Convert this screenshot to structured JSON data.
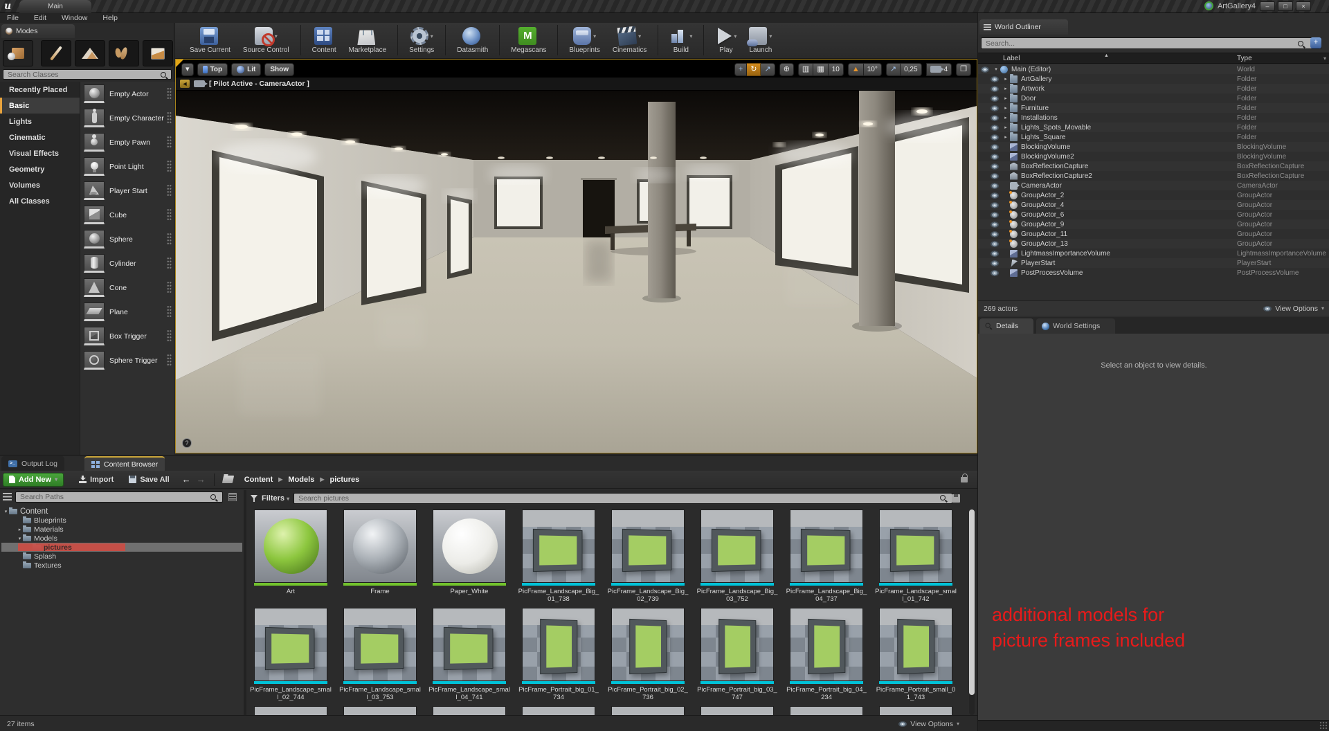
{
  "window": {
    "tab": "Main",
    "project": "ArtGallery4",
    "menu": [
      "File",
      "Edit",
      "Window",
      "Help"
    ],
    "buttons": {
      "minimize": "–",
      "restore": "□",
      "close": "×"
    }
  },
  "modes_panel": {
    "title": "Modes",
    "search_placeholder": "Search Classes",
    "categories": [
      {
        "label": "Recently Placed",
        "cls": ""
      },
      {
        "label": "Basic",
        "cls": "sel"
      },
      {
        "label": "Lights",
        "cls": ""
      },
      {
        "label": "Cinematic",
        "cls": ""
      },
      {
        "label": "Visual Effects",
        "cls": ""
      },
      {
        "label": "Geometry",
        "cls": ""
      },
      {
        "label": "Volumes",
        "cls": ""
      },
      {
        "label": "All Classes",
        "cls": ""
      }
    ],
    "items": [
      {
        "label": "Empty Actor",
        "icon": "ic-sphere"
      },
      {
        "label": "Empty Character",
        "icon": "ic-char"
      },
      {
        "label": "Empty Pawn",
        "icon": "ic-pawn"
      },
      {
        "label": "Point Light",
        "icon": "ic-bulb"
      },
      {
        "label": "Player Start",
        "icon": "ic-pstart"
      },
      {
        "label": "Cube",
        "icon": "ic-cube"
      },
      {
        "label": "Sphere",
        "icon": "ic-sphere"
      },
      {
        "label": "Cylinder",
        "icon": "ic-cyl"
      },
      {
        "label": "Cone",
        "icon": "ic-cone"
      },
      {
        "label": "Plane",
        "icon": "ic-plane"
      },
      {
        "label": "Box Trigger",
        "icon": "ic-boxtrig"
      },
      {
        "label": "Sphere Trigger",
        "icon": "ic-spheretrig"
      }
    ]
  },
  "toolbar": {
    "buttons": [
      {
        "label": "Save Current",
        "icon": "tb-save",
        "caret": "",
        "cls": "",
        "m": ""
      },
      {
        "label": "Source Control",
        "icon": "tb-sc",
        "caret": "▾",
        "cls": "",
        "m": ""
      },
      {
        "label": "Content",
        "icon": "tb-content",
        "caret": "",
        "cls": "sep",
        "m": ""
      },
      {
        "label": "Marketplace",
        "icon": "tb-market",
        "caret": "",
        "cls": "",
        "m": ""
      },
      {
        "label": "Settings",
        "icon": "tb-settings",
        "caret": "▾",
        "cls": "sep",
        "m": ""
      },
      {
        "label": "Datasmith",
        "icon": "tb-datasmith",
        "caret": "",
        "cls": "sep",
        "m": ""
      },
      {
        "label": "Megascans",
        "icon": "tb-megascans",
        "caret": "",
        "cls": "sep",
        "m": "M"
      },
      {
        "label": "Blueprints",
        "icon": "tb-bp",
        "caret": "▾",
        "cls": "sep",
        "m": ""
      },
      {
        "label": "Cinematics",
        "icon": "tb-cine",
        "caret": "▾",
        "cls": "",
        "m": ""
      },
      {
        "label": "Build",
        "icon": "tb-build",
        "caret": "▾",
        "cls": "sep",
        "m": ""
      },
      {
        "label": "Play",
        "icon": "tb-play",
        "caret": "▾",
        "cls": "sep",
        "m": ""
      },
      {
        "label": "Launch",
        "icon": "tb-launch",
        "caret": "▾",
        "cls": "",
        "m": ""
      }
    ]
  },
  "viewport": {
    "dropdown": "▾",
    "view_mode": "Top",
    "lit_mode": "Lit",
    "show_menu": "Show",
    "pilot_label": "[ Pilot Active - CameraActor ]",
    "help": "?",
    "controls": {
      "move": "+",
      "rotate": "↻",
      "scale": "↗",
      "world": "⊕",
      "surface": "▥",
      "grid": "▦",
      "grid_snap": "10",
      "rot_icon": "▲",
      "rot_snap": "10°",
      "scale_icon": "↗",
      "scale_snap": "0,25",
      "camera_speed": "4",
      "maximize": "❐"
    }
  },
  "world_outliner": {
    "title": "World Outliner",
    "search_placeholder": "Search...",
    "add_icon": "+",
    "col_label": "Label",
    "col_type": "Type",
    "sort": "▲",
    "filter_caret": "▾",
    "rows": [
      {
        "label": "Main (Editor)",
        "type": "World",
        "ind": "i0",
        "icon": "oi-w",
        "exp": "▾"
      },
      {
        "label": "ArtGallery",
        "type": "Folder",
        "ind": "i1",
        "icon": "oi-f",
        "exp": "▸"
      },
      {
        "label": "Artwork",
        "type": "Folder",
        "ind": "i1",
        "icon": "oi-f",
        "exp": "▸"
      },
      {
        "label": "Door",
        "type": "Folder",
        "ind": "i1",
        "icon": "oi-f",
        "exp": "▸"
      },
      {
        "label": "Furniture",
        "type": "Folder",
        "ind": "i1",
        "icon": "oi-f",
        "exp": "▸"
      },
      {
        "label": "Installations",
        "type": "Folder",
        "ind": "i1",
        "icon": "oi-f",
        "exp": "▸"
      },
      {
        "label": "Lights_Spots_Movable",
        "type": "Folder",
        "ind": "i1",
        "icon": "oi-f",
        "exp": "▸"
      },
      {
        "label": "Lights_Square",
        "type": "Folder",
        "ind": "i1",
        "icon": "oi-f",
        "exp": "▸"
      },
      {
        "label": "BlockingVolume",
        "type": "BlockingVolume",
        "ind": "i1",
        "icon": "oi-v",
        "exp": ""
      },
      {
        "label": "BlockingVolume2",
        "type": "BlockingVolume",
        "ind": "i1",
        "icon": "oi-v",
        "exp": ""
      },
      {
        "label": "BoxReflectionCapture",
        "type": "BoxReflectionCapture",
        "ind": "i1",
        "icon": "oi-rc",
        "exp": ""
      },
      {
        "label": "BoxReflectionCapture2",
        "type": "BoxReflectionCapture",
        "ind": "i1",
        "icon": "oi-rc",
        "exp": ""
      },
      {
        "label": "CameraActor",
        "type": "CameraActor",
        "ind": "i1",
        "icon": "oi-cam",
        "exp": ""
      },
      {
        "label": "GroupActor_2",
        "type": "GroupActor",
        "ind": "i1",
        "icon": "oi-g",
        "exp": ""
      },
      {
        "label": "GroupActor_4",
        "type": "GroupActor",
        "ind": "i1",
        "icon": "oi-g",
        "exp": ""
      },
      {
        "label": "GroupActor_6",
        "type": "GroupActor",
        "ind": "i1",
        "icon": "oi-g",
        "exp": ""
      },
      {
        "label": "GroupActor_9",
        "type": "GroupActor",
        "ind": "i1",
        "icon": "oi-g",
        "exp": ""
      },
      {
        "label": "GroupActor_11",
        "type": "GroupActor",
        "ind": "i1",
        "icon": "oi-g",
        "exp": ""
      },
      {
        "label": "GroupActor_13",
        "type": "GroupActor",
        "ind": "i1",
        "icon": "oi-g",
        "exp": ""
      },
      {
        "label": "LightmassImportanceVolume",
        "type": "LightmassImportanceVolume",
        "ind": "i1",
        "icon": "oi-v",
        "exp": ""
      },
      {
        "label": "PlayerStart",
        "type": "PlayerStart",
        "ind": "i1",
        "icon": "oi-ps",
        "exp": ""
      },
      {
        "label": "PostProcessVolume",
        "type": "PostProcessVolume",
        "ind": "i1",
        "icon": "oi-v",
        "exp": ""
      }
    ],
    "footer": {
      "count": "269 actors",
      "view_options": "View Options",
      "caret": "▾"
    }
  },
  "details_panel": {
    "tab_details": "Details",
    "tab_world_settings": "World Settings",
    "empty_message": "Select an object to view details."
  },
  "annotation": {
    "line1": "additional models for",
    "line2": "picture frames included",
    "color": "#e81a1a"
  },
  "content_browser": {
    "tab_output_log": "Output Log",
    "tab_content_browser": "Content Browser",
    "add_new": "Add New",
    "add_caret": "▾",
    "import": "Import",
    "save_all": "Save All",
    "back": "←",
    "forward": "→",
    "breadcrumb": [
      {
        "pre": "",
        "label": "Content"
      },
      {
        "pre": "▶",
        "label": "Models"
      },
      {
        "pre": "▶",
        "label": "pictures"
      }
    ],
    "search_paths_placeholder": "Search Paths",
    "filters": "Filters",
    "filters_caret": "▾",
    "search_assets_placeholder": "Search pictures",
    "tree": [
      {
        "label": "Content",
        "ind": "t0",
        "exp": "▾",
        "cls": ""
      },
      {
        "label": "Blueprints",
        "ind": "t1",
        "exp": "",
        "cls": ""
      },
      {
        "label": "Materials",
        "ind": "t1",
        "exp": "▸",
        "cls": ""
      },
      {
        "label": "Models",
        "ind": "t1",
        "exp": "▾",
        "cls": ""
      },
      {
        "label": "pictures",
        "ind": "t2",
        "exp": "",
        "cls": "sel"
      },
      {
        "label": "Splash",
        "ind": "t1",
        "exp": "",
        "cls": ""
      },
      {
        "label": "Textures",
        "ind": "t1",
        "exp": "",
        "cls": ""
      }
    ],
    "assets_row1": [
      {
        "name": "Art",
        "kind": "k-sgreen",
        "bar": "b-mat"
      },
      {
        "name": "Frame",
        "kind": "k-sgray",
        "bar": "b-mat"
      },
      {
        "name": "Paper_White",
        "kind": "k-swhite",
        "bar": "b-mat"
      },
      {
        "name": "PicFrame_Landscape_Big_01_738",
        "kind": "k-fland",
        "bar": "b-mesh"
      },
      {
        "name": "PicFrame_Landscape_Big_02_739",
        "kind": "k-fland",
        "bar": "b-mesh"
      },
      {
        "name": "PicFrame_Landscape_Big_03_752",
        "kind": "k-fland",
        "bar": "b-mesh"
      },
      {
        "name": "PicFrame_Landscape_Big_04_737",
        "kind": "k-fland",
        "bar": "b-mesh"
      },
      {
        "name": "PicFrame_Landscape_small_01_742",
        "kind": "k-fland",
        "bar": "b-mesh"
      }
    ],
    "assets_row2": [
      {
        "name": "PicFrame_Landscape_small_02_744",
        "kind": "k-fland",
        "bar": "b-mesh"
      },
      {
        "name": "PicFrame_Landscape_small_03_753",
        "kind": "k-fland",
        "bar": "b-mesh"
      },
      {
        "name": "PicFrame_Landscape_small_04_741",
        "kind": "k-fland",
        "bar": "b-mesh"
      },
      {
        "name": "PicFrame_Portrait_big_01_734",
        "kind": "k-fport",
        "bar": "b-mesh"
      },
      {
        "name": "PicFrame_Portrait_big_02_736",
        "kind": "k-fport",
        "bar": "b-mesh"
      },
      {
        "name": "PicFrame_Portrait_big_03_747",
        "kind": "k-fport",
        "bar": "b-mesh"
      },
      {
        "name": "PicFrame_Portrait_big_04_234",
        "kind": "k-fport",
        "bar": "b-mesh"
      },
      {
        "name": "PicFrame_Portrait_small_01_743",
        "kind": "k-fport",
        "bar": "b-mesh"
      }
    ],
    "items_count": "27 items",
    "view_options": "View Options",
    "colors": {
      "material_bar": "#72c22c",
      "mesh_bar": "#00c2d8",
      "selection_red": "#cf4a41",
      "add_new_green": "#3f9b35"
    }
  }
}
